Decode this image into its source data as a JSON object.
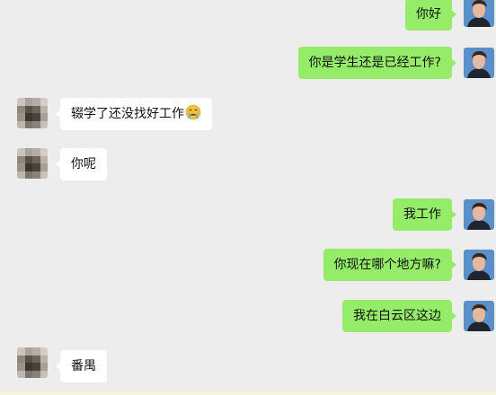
{
  "messages": [
    {
      "sender": "self",
      "text": "你好"
    },
    {
      "sender": "self",
      "text": "你是学生还是已经工作?"
    },
    {
      "sender": "other",
      "text": "辍学了还没找好工作",
      "emoji": "crying-face-icon"
    },
    {
      "sender": "other",
      "text": "你呢"
    },
    {
      "sender": "self",
      "text": "我工作"
    },
    {
      "sender": "self",
      "text": "你现在哪个地方嘛?"
    },
    {
      "sender": "self",
      "text": "我在白云区这边"
    },
    {
      "sender": "other",
      "text": "番禺"
    }
  ],
  "colors": {
    "background": "#ededed",
    "self_bubble": "#95ec69",
    "other_bubble": "#ffffff",
    "self_avatar_bg": "#5a8fc8"
  }
}
